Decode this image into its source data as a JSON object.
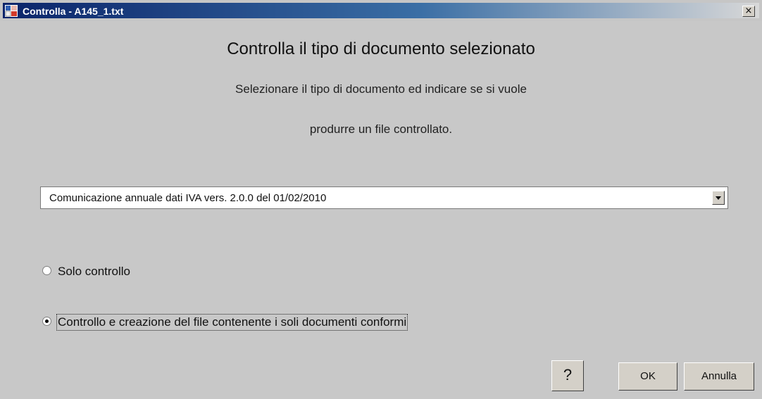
{
  "window": {
    "title": "Controlla - A145_1.txt",
    "close_label": "×"
  },
  "dialog": {
    "heading": "Controlla il tipo di documento selezionato",
    "instruction_line1": "Selezionare il tipo di documento ed indicare se si vuole",
    "instruction_line2": "produrre un file controllato."
  },
  "document_type": {
    "selected": "Comunicazione annuale dati IVA vers. 2.0.0 del 01/02/2010"
  },
  "options": [
    {
      "label": "Solo controllo",
      "checked": false
    },
    {
      "label": "Controllo e creazione del file contenente i soli documenti conformi",
      "checked": true
    }
  ],
  "buttons": {
    "help": "?",
    "ok": "OK",
    "cancel": "Annulla"
  },
  "colors": {
    "titlebar_start": "#0a246a",
    "titlebar_end": "#d8d8d8",
    "dialog_background": "#c8c8c8"
  }
}
